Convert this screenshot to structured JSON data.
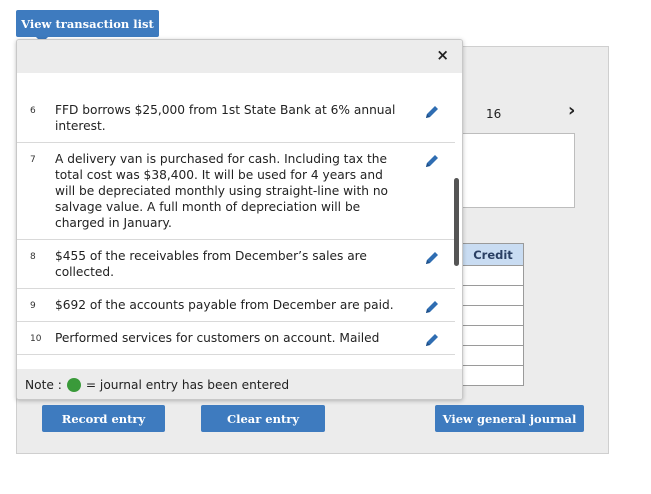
{
  "top": {
    "view_list_label": "View transaction list"
  },
  "panel": {
    "page_number": "16",
    "next_glyph": "›"
  },
  "entry_table": {
    "credit_header": "Credit",
    "rows": 6
  },
  "buttons": {
    "record": "Record entry",
    "clear": "Clear entry",
    "view_journal": "View general journal"
  },
  "modal": {
    "close_glyph": "×",
    "transactions": [
      {
        "num": "6",
        "text": "FFD borrows $25,000 from 1st State Bank at 6% annual interest."
      },
      {
        "num": "7",
        "text": "A delivery van is purchased for cash. Including tax the total cost was $38,400. It will be used for 4 years and will be depreciated monthly using straight-line with no salvage value. A full month of depreciation will be charged in January."
      },
      {
        "num": "8",
        "text": "$455 of the receivables from December’s sales are collected."
      },
      {
        "num": "9",
        "text": "$692 of the accounts payable from December are paid."
      },
      {
        "num": "10",
        "text": "Performed services for customers on account. Mailed"
      }
    ],
    "note": {
      "label": "Note :",
      "text": "= journal entry has been entered"
    }
  },
  "colors": {
    "button": "#3e7bbf",
    "edit_icon": "#2f6db2",
    "entered_dot": "#3a9a3a"
  }
}
